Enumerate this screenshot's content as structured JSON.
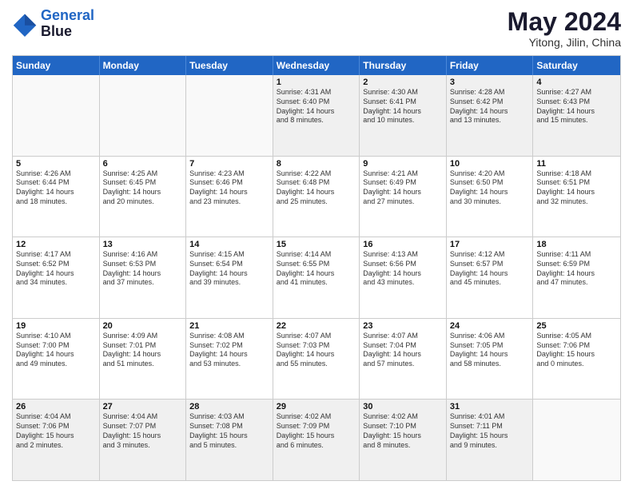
{
  "header": {
    "logo_line1": "General",
    "logo_line2": "Blue",
    "month_title": "May 2024",
    "location": "Yitong, Jilin, China"
  },
  "day_headers": [
    "Sunday",
    "Monday",
    "Tuesday",
    "Wednesday",
    "Thursday",
    "Friday",
    "Saturday"
  ],
  "weeks": [
    [
      {
        "num": "",
        "info": "",
        "empty": true
      },
      {
        "num": "",
        "info": "",
        "empty": true
      },
      {
        "num": "",
        "info": "",
        "empty": true
      },
      {
        "num": "1",
        "info": "Sunrise: 4:31 AM\nSunset: 6:40 PM\nDaylight: 14 hours\nand 8 minutes.",
        "empty": false
      },
      {
        "num": "2",
        "info": "Sunrise: 4:30 AM\nSunset: 6:41 PM\nDaylight: 14 hours\nand 10 minutes.",
        "empty": false
      },
      {
        "num": "3",
        "info": "Sunrise: 4:28 AM\nSunset: 6:42 PM\nDaylight: 14 hours\nand 13 minutes.",
        "empty": false
      },
      {
        "num": "4",
        "info": "Sunrise: 4:27 AM\nSunset: 6:43 PM\nDaylight: 14 hours\nand 15 minutes.",
        "empty": false
      }
    ],
    [
      {
        "num": "5",
        "info": "Sunrise: 4:26 AM\nSunset: 6:44 PM\nDaylight: 14 hours\nand 18 minutes.",
        "empty": false
      },
      {
        "num": "6",
        "info": "Sunrise: 4:25 AM\nSunset: 6:45 PM\nDaylight: 14 hours\nand 20 minutes.",
        "empty": false
      },
      {
        "num": "7",
        "info": "Sunrise: 4:23 AM\nSunset: 6:46 PM\nDaylight: 14 hours\nand 23 minutes.",
        "empty": false
      },
      {
        "num": "8",
        "info": "Sunrise: 4:22 AM\nSunset: 6:48 PM\nDaylight: 14 hours\nand 25 minutes.",
        "empty": false
      },
      {
        "num": "9",
        "info": "Sunrise: 4:21 AM\nSunset: 6:49 PM\nDaylight: 14 hours\nand 27 minutes.",
        "empty": false
      },
      {
        "num": "10",
        "info": "Sunrise: 4:20 AM\nSunset: 6:50 PM\nDaylight: 14 hours\nand 30 minutes.",
        "empty": false
      },
      {
        "num": "11",
        "info": "Sunrise: 4:18 AM\nSunset: 6:51 PM\nDaylight: 14 hours\nand 32 minutes.",
        "empty": false
      }
    ],
    [
      {
        "num": "12",
        "info": "Sunrise: 4:17 AM\nSunset: 6:52 PM\nDaylight: 14 hours\nand 34 minutes.",
        "empty": false
      },
      {
        "num": "13",
        "info": "Sunrise: 4:16 AM\nSunset: 6:53 PM\nDaylight: 14 hours\nand 37 minutes.",
        "empty": false
      },
      {
        "num": "14",
        "info": "Sunrise: 4:15 AM\nSunset: 6:54 PM\nDaylight: 14 hours\nand 39 minutes.",
        "empty": false
      },
      {
        "num": "15",
        "info": "Sunrise: 4:14 AM\nSunset: 6:55 PM\nDaylight: 14 hours\nand 41 minutes.",
        "empty": false
      },
      {
        "num": "16",
        "info": "Sunrise: 4:13 AM\nSunset: 6:56 PM\nDaylight: 14 hours\nand 43 minutes.",
        "empty": false
      },
      {
        "num": "17",
        "info": "Sunrise: 4:12 AM\nSunset: 6:57 PM\nDaylight: 14 hours\nand 45 minutes.",
        "empty": false
      },
      {
        "num": "18",
        "info": "Sunrise: 4:11 AM\nSunset: 6:59 PM\nDaylight: 14 hours\nand 47 minutes.",
        "empty": false
      }
    ],
    [
      {
        "num": "19",
        "info": "Sunrise: 4:10 AM\nSunset: 7:00 PM\nDaylight: 14 hours\nand 49 minutes.",
        "empty": false
      },
      {
        "num": "20",
        "info": "Sunrise: 4:09 AM\nSunset: 7:01 PM\nDaylight: 14 hours\nand 51 minutes.",
        "empty": false
      },
      {
        "num": "21",
        "info": "Sunrise: 4:08 AM\nSunset: 7:02 PM\nDaylight: 14 hours\nand 53 minutes.",
        "empty": false
      },
      {
        "num": "22",
        "info": "Sunrise: 4:07 AM\nSunset: 7:03 PM\nDaylight: 14 hours\nand 55 minutes.",
        "empty": false
      },
      {
        "num": "23",
        "info": "Sunrise: 4:07 AM\nSunset: 7:04 PM\nDaylight: 14 hours\nand 57 minutes.",
        "empty": false
      },
      {
        "num": "24",
        "info": "Sunrise: 4:06 AM\nSunset: 7:05 PM\nDaylight: 14 hours\nand 58 minutes.",
        "empty": false
      },
      {
        "num": "25",
        "info": "Sunrise: 4:05 AM\nSunset: 7:06 PM\nDaylight: 15 hours\nand 0 minutes.",
        "empty": false
      }
    ],
    [
      {
        "num": "26",
        "info": "Sunrise: 4:04 AM\nSunset: 7:06 PM\nDaylight: 15 hours\nand 2 minutes.",
        "empty": false
      },
      {
        "num": "27",
        "info": "Sunrise: 4:04 AM\nSunset: 7:07 PM\nDaylight: 15 hours\nand 3 minutes.",
        "empty": false
      },
      {
        "num": "28",
        "info": "Sunrise: 4:03 AM\nSunset: 7:08 PM\nDaylight: 15 hours\nand 5 minutes.",
        "empty": false
      },
      {
        "num": "29",
        "info": "Sunrise: 4:02 AM\nSunset: 7:09 PM\nDaylight: 15 hours\nand 6 minutes.",
        "empty": false
      },
      {
        "num": "30",
        "info": "Sunrise: 4:02 AM\nSunset: 7:10 PM\nDaylight: 15 hours\nand 8 minutes.",
        "empty": false
      },
      {
        "num": "31",
        "info": "Sunrise: 4:01 AM\nSunset: 7:11 PM\nDaylight: 15 hours\nand 9 minutes.",
        "empty": false
      },
      {
        "num": "",
        "info": "",
        "empty": true
      }
    ]
  ]
}
